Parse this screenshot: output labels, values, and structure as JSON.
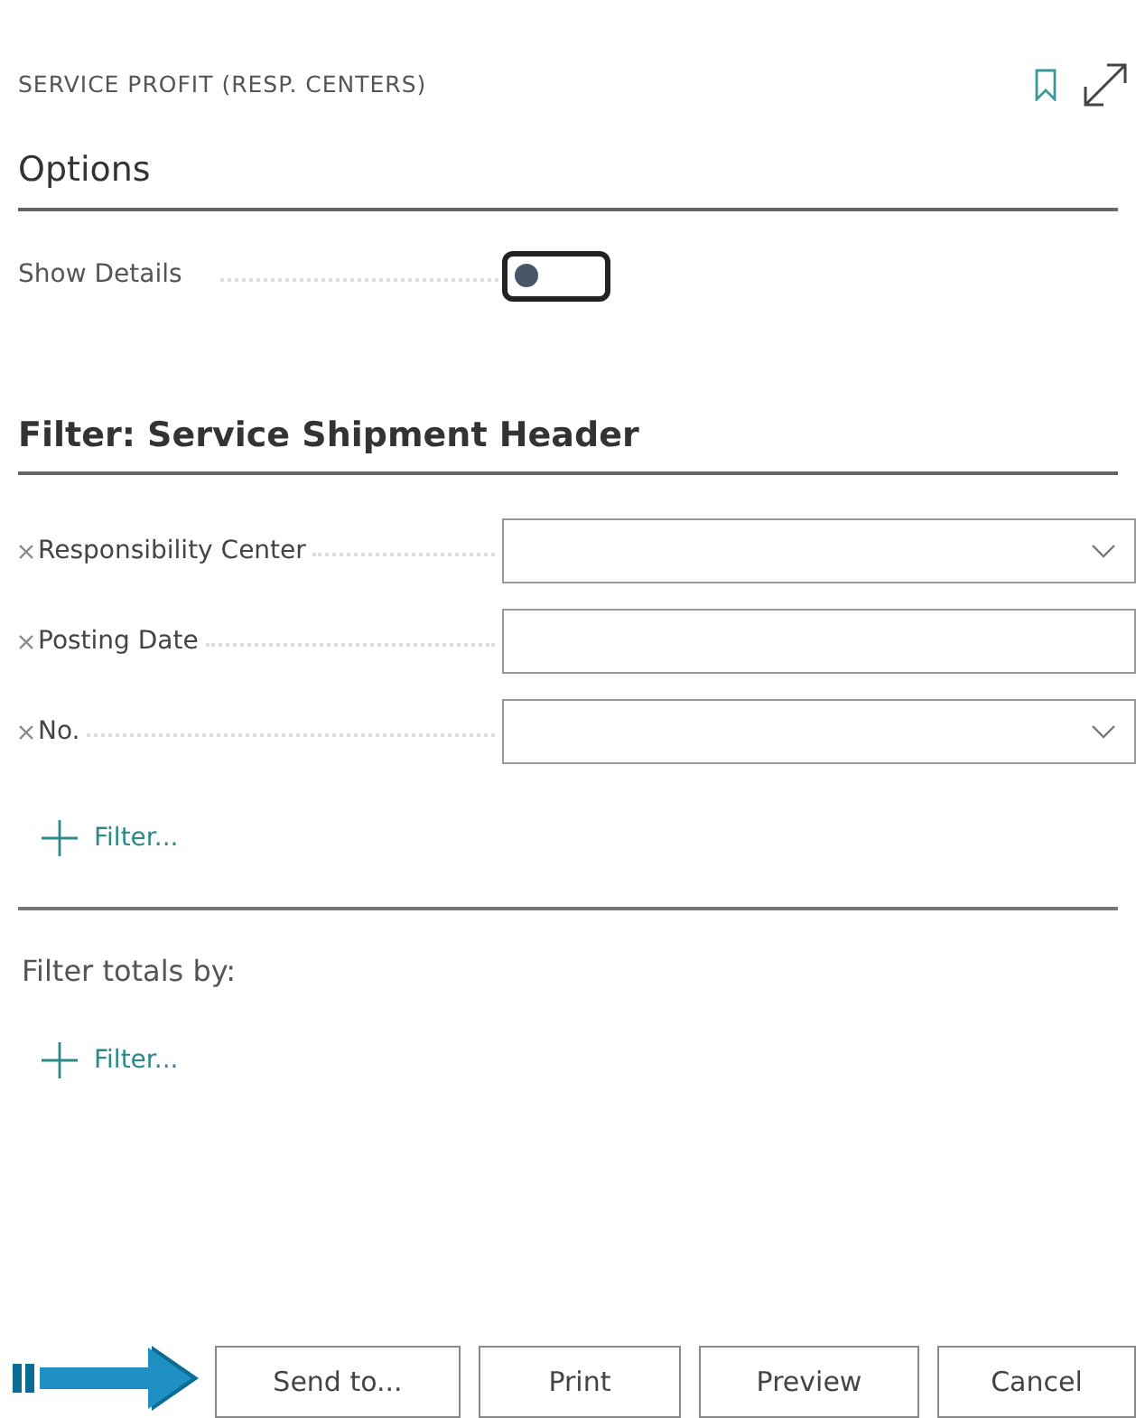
{
  "header": {
    "title": "SERVICE PROFIT (RESP. CENTERS)"
  },
  "options": {
    "heading": "Options",
    "fields": [
      {
        "label": "Show Details",
        "on": false
      }
    ]
  },
  "filter": {
    "heading": "Filter: Service Shipment Header",
    "fields": [
      {
        "label": "Responsibility Center",
        "kind": "dropdown"
      },
      {
        "label": "Posting Date",
        "kind": "text"
      },
      {
        "label": "No.",
        "kind": "dropdown"
      }
    ],
    "add_filter": "Filter..."
  },
  "totals": {
    "heading": "Filter totals by:",
    "add_filter": "Filter..."
  },
  "buttons": [
    "Send to...",
    "Print",
    "Preview",
    "Cancel"
  ]
}
